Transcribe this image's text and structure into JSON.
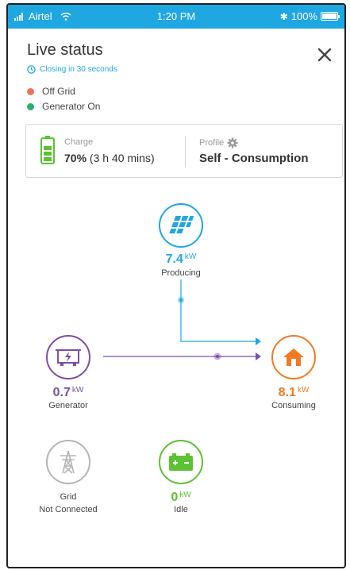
{
  "status_bar": {
    "carrier": "Airtel",
    "time": "1:20 PM",
    "battery": "100%"
  },
  "header": {
    "title": "Live status",
    "closing_text": "Closing in 30 seconds"
  },
  "legend": [
    {
      "label": "Off Grid",
      "color": "#f0705a"
    },
    {
      "label": "Generator On",
      "color": "#27b36a"
    }
  ],
  "summary_card": {
    "charge_label": "Charge",
    "charge_percent": "70%",
    "charge_time": "(3 h 40 mins)",
    "profile_label": "Profile",
    "profile_value": "Self - Consumption"
  },
  "nodes": {
    "solar": {
      "value": "7.4",
      "unit": "kW",
      "label": "Producing",
      "color": "#1fa7e1",
      "icon": "solar-panel-icon"
    },
    "generator": {
      "value": "0.7",
      "unit": "kW",
      "label": "Generator",
      "color": "#7b4fa6",
      "icon": "generator-icon"
    },
    "home": {
      "value": "8.1",
      "unit": "kW",
      "label": "Consuming",
      "color": "#f07a24",
      "icon": "home-icon"
    },
    "grid": {
      "label_line1": "Grid",
      "label_line2": "Not Connected",
      "color": "#b5b5b5",
      "icon": "power-tower-icon"
    },
    "battery": {
      "value": "0",
      "unit": "kW",
      "label": "Idle",
      "color": "#5cc234",
      "icon": "battery-icon"
    }
  }
}
